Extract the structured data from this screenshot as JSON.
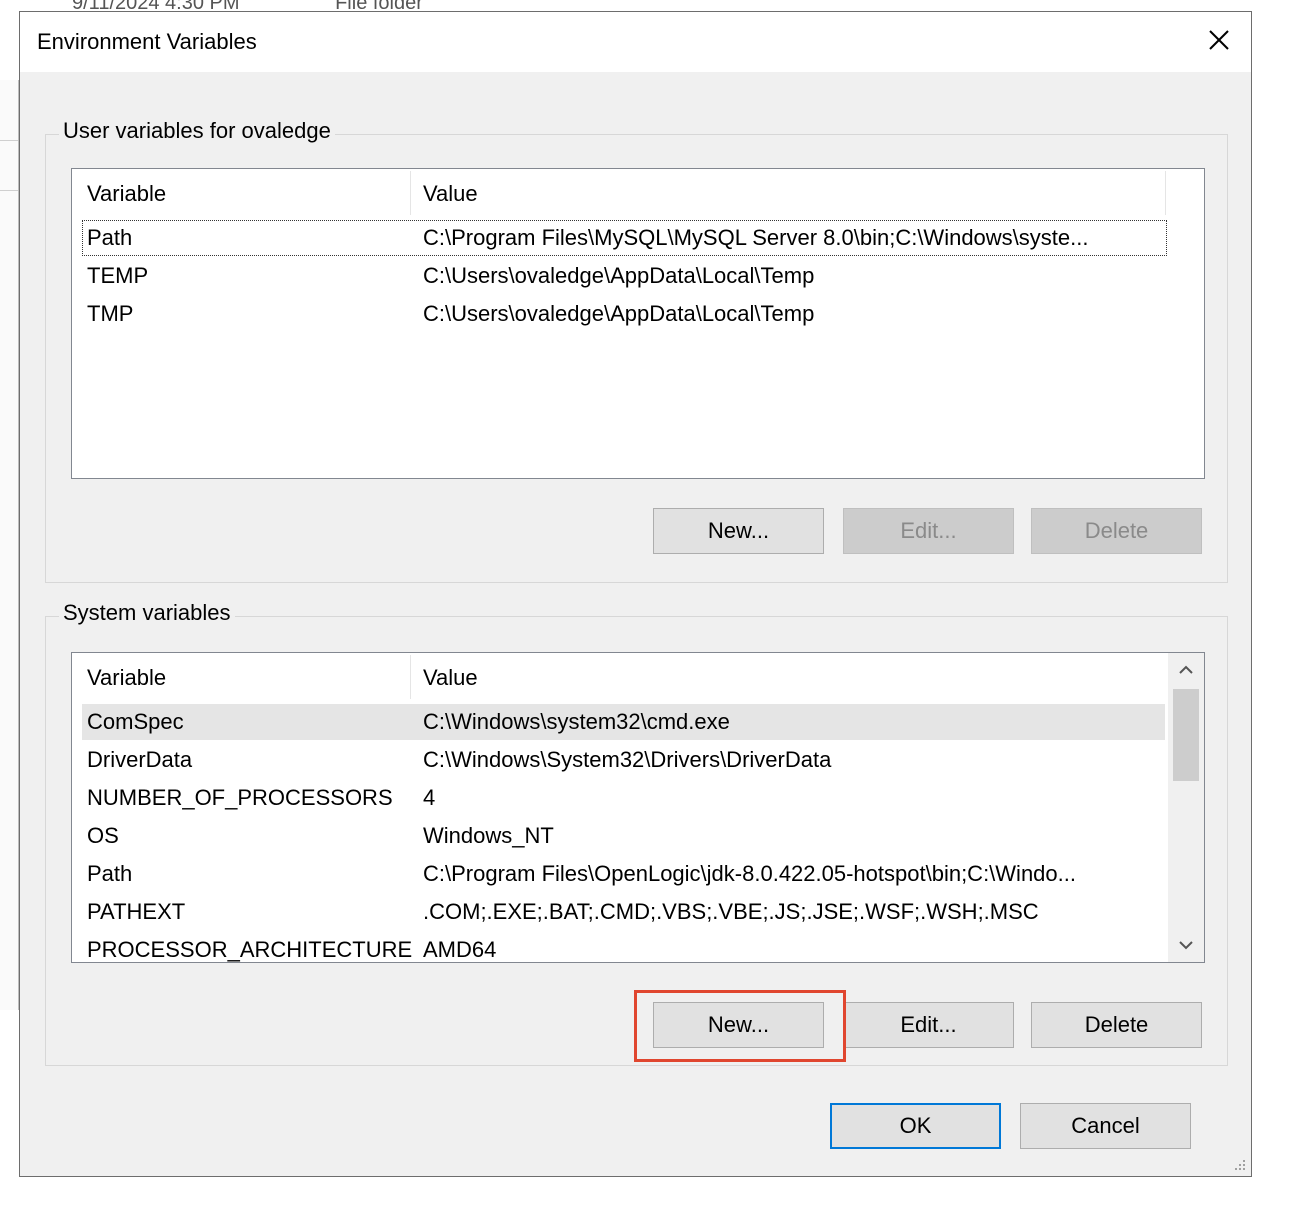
{
  "background": {
    "date_modified": "9/11/2024 4:30 PM",
    "type": "File folder"
  },
  "dialog": {
    "title": "Environment Variables",
    "close_icon": "close-icon"
  },
  "user_vars": {
    "group_label": "User variables for ovaledge",
    "columns": [
      "Variable",
      "Value"
    ],
    "rows": [
      {
        "name": "Path",
        "value": "C:\\Program Files\\MySQL\\MySQL Server 8.0\\bin;C:\\Windows\\syste..."
      },
      {
        "name": "TEMP",
        "value": "C:\\Users\\ovaledge\\AppData\\Local\\Temp"
      },
      {
        "name": "TMP",
        "value": "C:\\Users\\ovaledge\\AppData\\Local\\Temp"
      }
    ],
    "buttons": {
      "new": "New...",
      "edit": "Edit...",
      "delete": "Delete"
    }
  },
  "system_vars": {
    "group_label": "System variables",
    "columns": [
      "Variable",
      "Value"
    ],
    "rows": [
      {
        "name": "ComSpec",
        "value": "C:\\Windows\\system32\\cmd.exe"
      },
      {
        "name": "DriverData",
        "value": "C:\\Windows\\System32\\Drivers\\DriverData"
      },
      {
        "name": "NUMBER_OF_PROCESSORS",
        "value": "4"
      },
      {
        "name": "OS",
        "value": "Windows_NT"
      },
      {
        "name": "Path",
        "value": "C:\\Program Files\\OpenLogic\\jdk-8.0.422.05-hotspot\\bin;C:\\Windo..."
      },
      {
        "name": "PATHEXT",
        "value": ".COM;.EXE;.BAT;.CMD;.VBS;.VBE;.JS;.JSE;.WSF;.WSH;.MSC"
      },
      {
        "name": "PROCESSOR_ARCHITECTURE",
        "value": "AMD64"
      }
    ],
    "buttons": {
      "new": "New...",
      "edit": "Edit...",
      "delete": "Delete"
    }
  },
  "footer": {
    "ok": "OK",
    "cancel": "Cancel"
  },
  "colors": {
    "highlight": "#e0462f",
    "default_button_border": "#0078d7"
  }
}
